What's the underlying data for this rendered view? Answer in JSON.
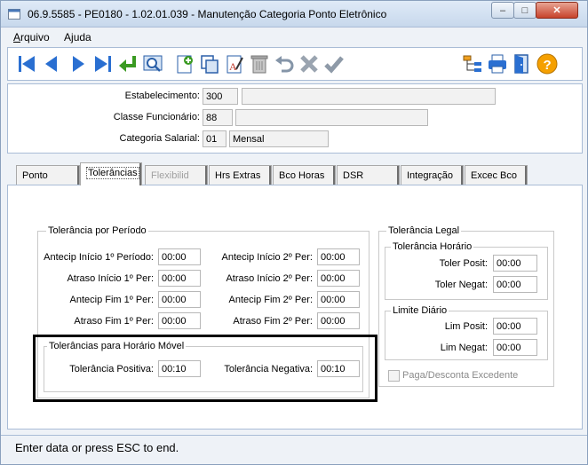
{
  "window": {
    "title": "06.9.5585 - PE0180 - 1.02.01.039 - Manutenção Categoria Ponto Eletrônico",
    "min_symbol": "–",
    "max_symbol": "□",
    "close_symbol": "✕"
  },
  "menu": {
    "items": [
      {
        "label": "Arquivo",
        "mnemonic": "A"
      },
      {
        "label": "Ajuda",
        "mnemonic": "j"
      }
    ]
  },
  "toolbar": {
    "buttons": [
      {
        "name": "first",
        "icon": "first-record-icon"
      },
      {
        "name": "previous",
        "icon": "previous-record-icon"
      },
      {
        "name": "next",
        "icon": "next-record-icon"
      },
      {
        "name": "last",
        "icon": "last-record-icon"
      },
      {
        "name": "goto",
        "icon": "goto-icon"
      },
      {
        "name": "search",
        "icon": "zoom-search-icon"
      },
      {
        "name": "add",
        "icon": "add-record-icon"
      },
      {
        "name": "copy",
        "icon": "copy-record-icon"
      },
      {
        "name": "edit",
        "icon": "edit-record-icon"
      },
      {
        "name": "delete",
        "icon": "trash-icon"
      },
      {
        "name": "undo",
        "icon": "undo-icon"
      },
      {
        "name": "cancel",
        "icon": "cancel-x-icon"
      },
      {
        "name": "ok",
        "icon": "check-icon"
      },
      {
        "name": "tree",
        "icon": "tree-icon"
      },
      {
        "name": "print",
        "icon": "printer-icon"
      },
      {
        "name": "exit",
        "icon": "exit-door-icon"
      },
      {
        "name": "help",
        "icon": "help-icon"
      }
    ]
  },
  "header": {
    "estabelecimento": {
      "label": "Estabelecimento:",
      "code": "300",
      "desc": ""
    },
    "classe": {
      "label": "Classe Funcionário:",
      "code": "88",
      "desc": ""
    },
    "categoria": {
      "label": "Categoria Salarial:",
      "code": "01",
      "desc": "Mensal"
    }
  },
  "tabs": [
    {
      "label": "Ponto",
      "state": "normal"
    },
    {
      "label": "Tolerâncias",
      "state": "active"
    },
    {
      "label": "Flexibilid",
      "state": "disabled"
    },
    {
      "label": "Hrs Extras",
      "state": "normal"
    },
    {
      "label": "Bco Horas",
      "state": "normal"
    },
    {
      "label": "DSR",
      "state": "normal"
    },
    {
      "label": "Integração",
      "state": "normal"
    },
    {
      "label": "Excec Bco",
      "state": "normal"
    }
  ],
  "tolerancia_periodo": {
    "title": "Tolerância por Período",
    "rows": [
      {
        "label_left": "Antecip Início 1º Período:",
        "value_left": "00:00",
        "label_right": "Antecip Início 2º Per:",
        "value_right": "00:00"
      },
      {
        "label_left": "Atraso Início 1º Per:",
        "value_left": "00:00",
        "label_right": "Atraso Início 2º Per:",
        "value_right": "00:00"
      },
      {
        "label_left": "Antecip Fim 1º Per:",
        "value_left": "00:00",
        "label_right": "Antecip Fim 2º Per:",
        "value_right": "00:00"
      },
      {
        "label_left": "Atraso Fim 1º Per:",
        "value_left": "00:00",
        "label_right": "Atraso Fim 2º Per:",
        "value_right": "00:00"
      }
    ]
  },
  "horario_movel": {
    "title": "Tolerâncias para Horário Móvel",
    "positiva_label": "Tolerância Positiva:",
    "positiva_value": "00:10",
    "negativa_label": "Tolerância Negativa:",
    "negativa_value": "00:10"
  },
  "tolerancia_legal": {
    "title": "Tolerância Legal",
    "horario": {
      "title": "Tolerância Horário",
      "posit_label": "Toler Posit:",
      "posit_value": "00:00",
      "negat_label": "Toler Negat:",
      "negat_value": "00:00"
    },
    "limite": {
      "title": "Limite Diário",
      "posit_label": "Lim Posit:",
      "posit_value": "00:00",
      "negat_label": "Lim Negat:",
      "negat_value": "00:00"
    },
    "paga_label": "Paga/Desconta Excedente"
  },
  "status": {
    "text": "Enter data or press ESC to end."
  }
}
